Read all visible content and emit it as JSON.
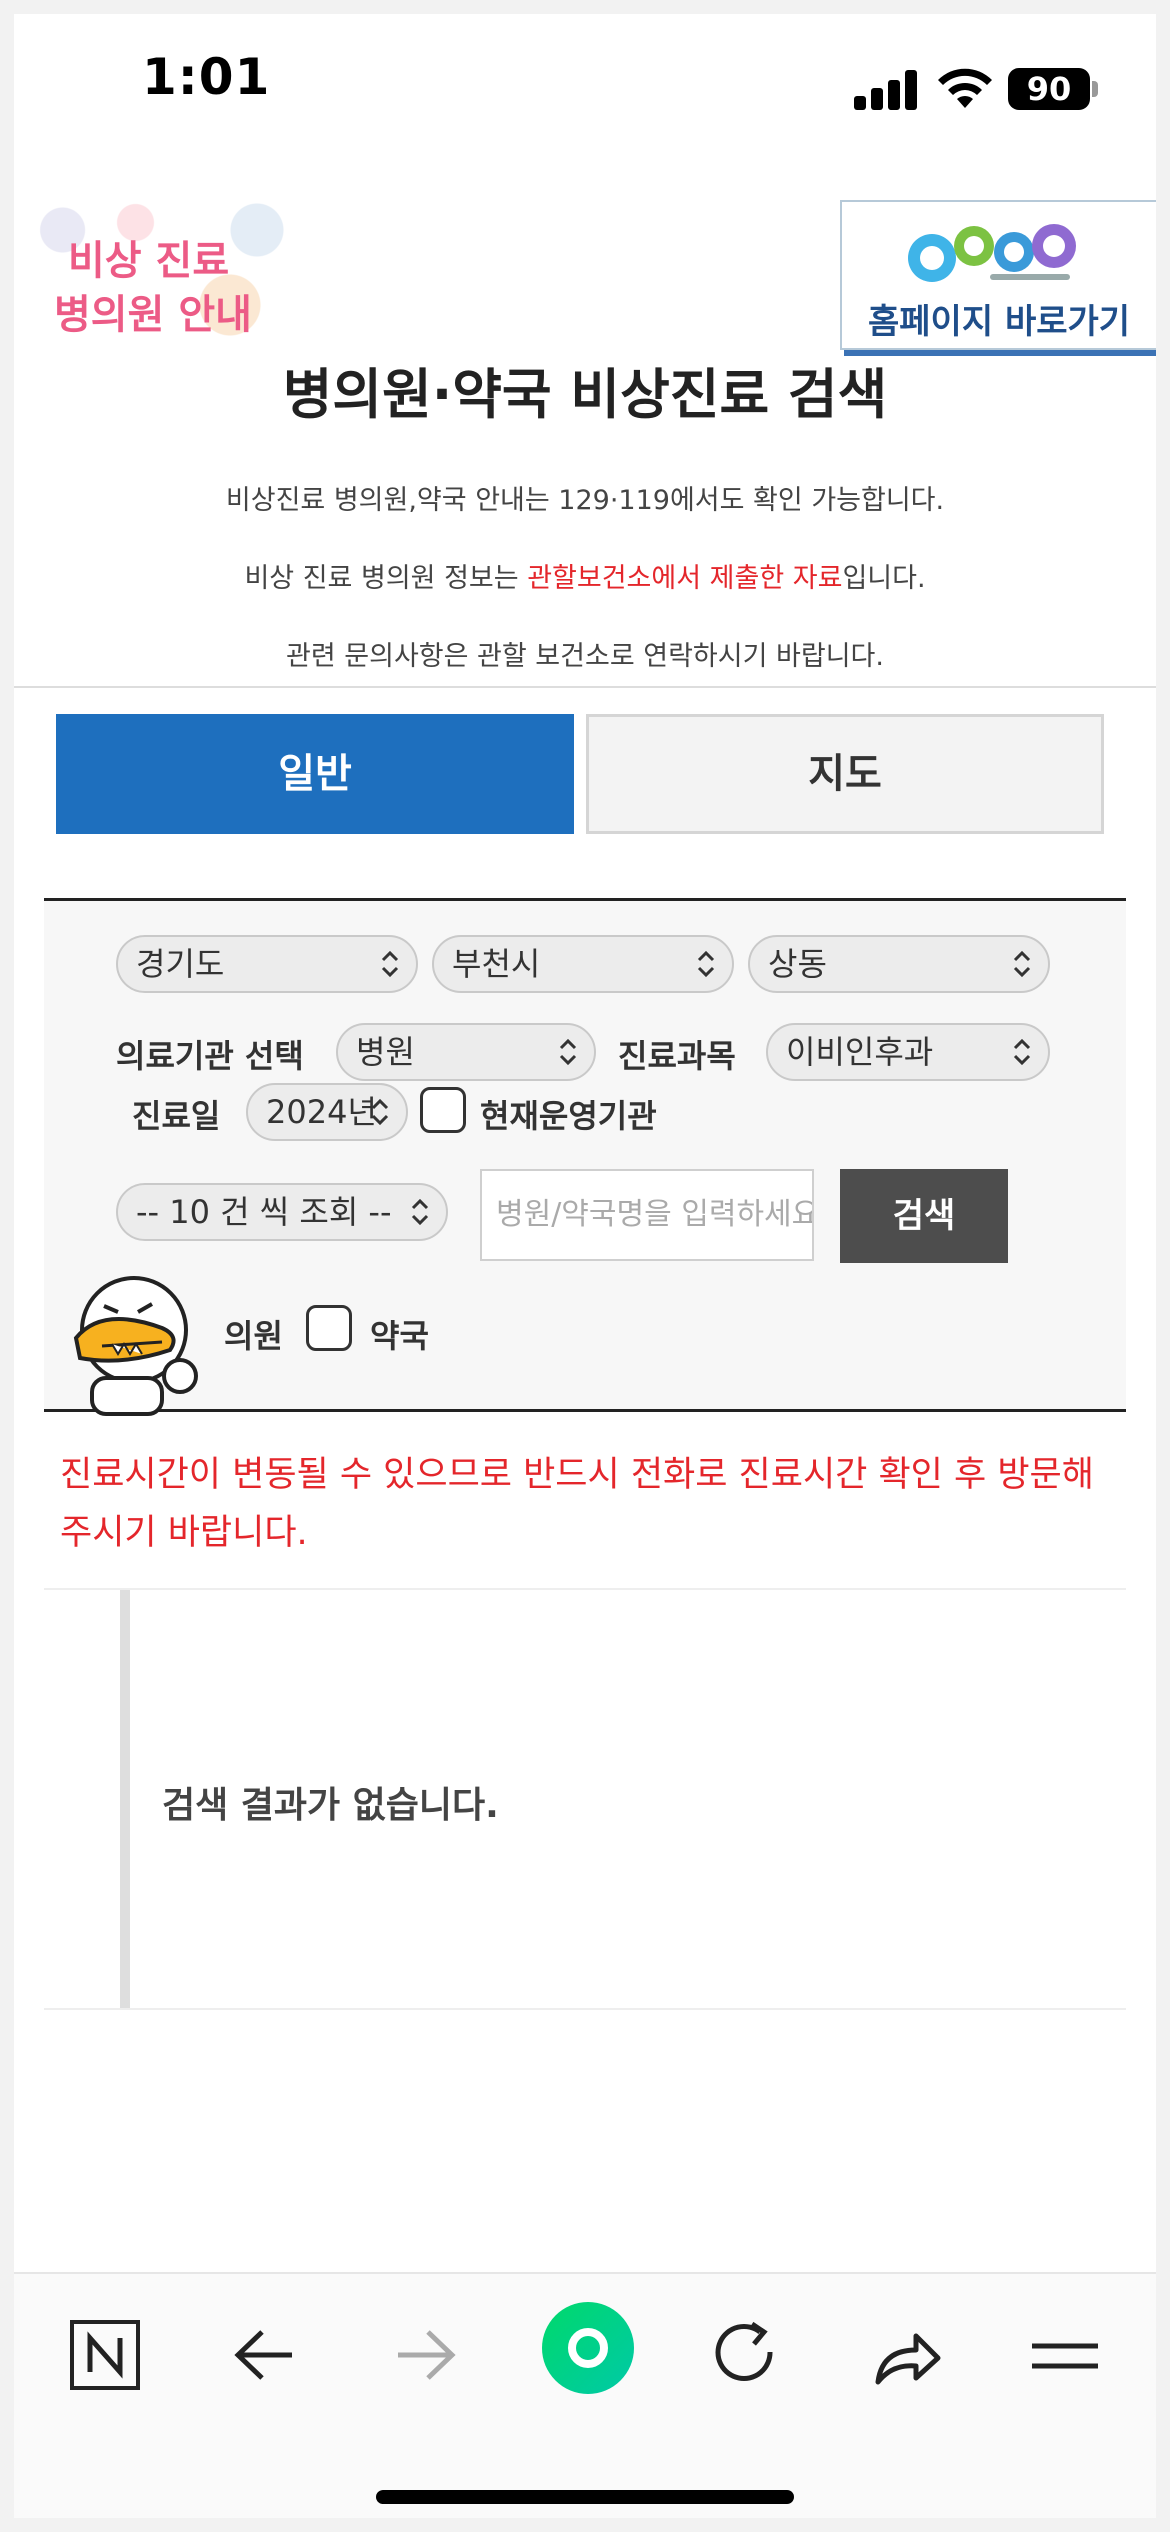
{
  "status_bar": {
    "time": "1:01",
    "battery": "90"
  },
  "banner": {
    "left_line1": "비상 진료",
    "left_line2": "병의원 안내",
    "right_link": "홈페이지 바로가기"
  },
  "header": {
    "title": "병의원·약국 비상진료 검색",
    "info1": "비상진료 병의원,약국 안내는 129·119에서도 확인 가능합니다.",
    "info2_pre": "비상 진료 병의원 정보는 ",
    "info2_red": "관할보건소에서 제출한 자료",
    "info2_post": "입니다.",
    "info3": "관련 문의사항은 관할 보건소로 연락하시기 바랍니다."
  },
  "tabs": {
    "general": "일반",
    "map": "지도"
  },
  "form": {
    "province": "경기도",
    "city": "부천시",
    "district": "상동",
    "institution_label": "의료기관 선택",
    "institution_value": "병원",
    "department_label": "진료과목",
    "department_value": "이비인후과",
    "date_label": "진료일",
    "date_value": "2024년",
    "operating_label": "현재운영기관",
    "page_size": "-- 10 건 씩 조회 --",
    "search_placeholder": "병원/약국명을 입력하세요",
    "search_button": "검색",
    "hospital_check_label": "의원",
    "pharmacy_check_label": "약국"
  },
  "notice": "진료시간이 변동될 수 있으므로 반드시 전화로 진료시간 확인 후 방문해주시기 바랍니다.",
  "result": {
    "empty": "검색 결과가 없습니다."
  },
  "colors": {
    "primary": "#1e6fbe",
    "alert": "#e4262b",
    "button_dark": "#4d4d4d"
  },
  "toolbar_icons": [
    "naver-n-icon",
    "back-arrow-icon",
    "forward-arrow-icon",
    "green-dot-icon",
    "reload-icon",
    "share-icon",
    "menu-icon"
  ]
}
